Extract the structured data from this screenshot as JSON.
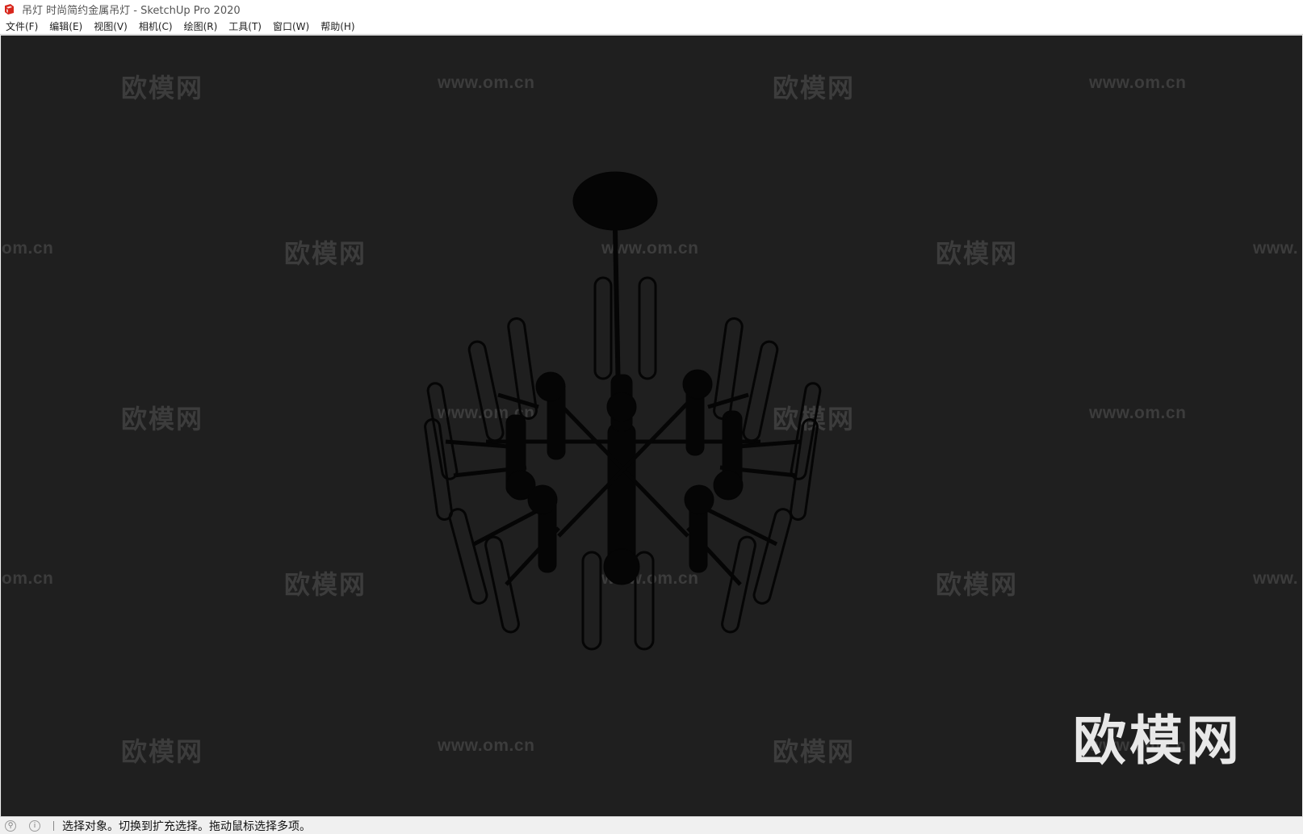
{
  "titlebar": {
    "icon": "sketchup-icon",
    "title": "吊灯 时尚简约金属吊灯 - SketchUp Pro 2020"
  },
  "menu": [
    {
      "label": "文件(F)"
    },
    {
      "label": "编辑(E)"
    },
    {
      "label": "视图(V)"
    },
    {
      "label": "相机(C)"
    },
    {
      "label": "绘图(R)"
    },
    {
      "label": "工具(T)"
    },
    {
      "label": "窗口(W)"
    },
    {
      "label": "帮助(H)"
    }
  ],
  "viewport": {
    "background": "#1f1f1f",
    "model_color": "#050505",
    "watermark_color": "#3c3c3c",
    "watermark_cn": "欧模网",
    "watermark_url": "www.om.cn",
    "watermark_url_cut_left": "om.cn",
    "watermark_url_cut_right": "www.",
    "big_watermark": "欧模网"
  },
  "statusbar": {
    "icons": [
      "geo-location-icon",
      "info-icon"
    ],
    "message": "选择对象。切换到扩充选择。拖动鼠标选择多项。"
  }
}
